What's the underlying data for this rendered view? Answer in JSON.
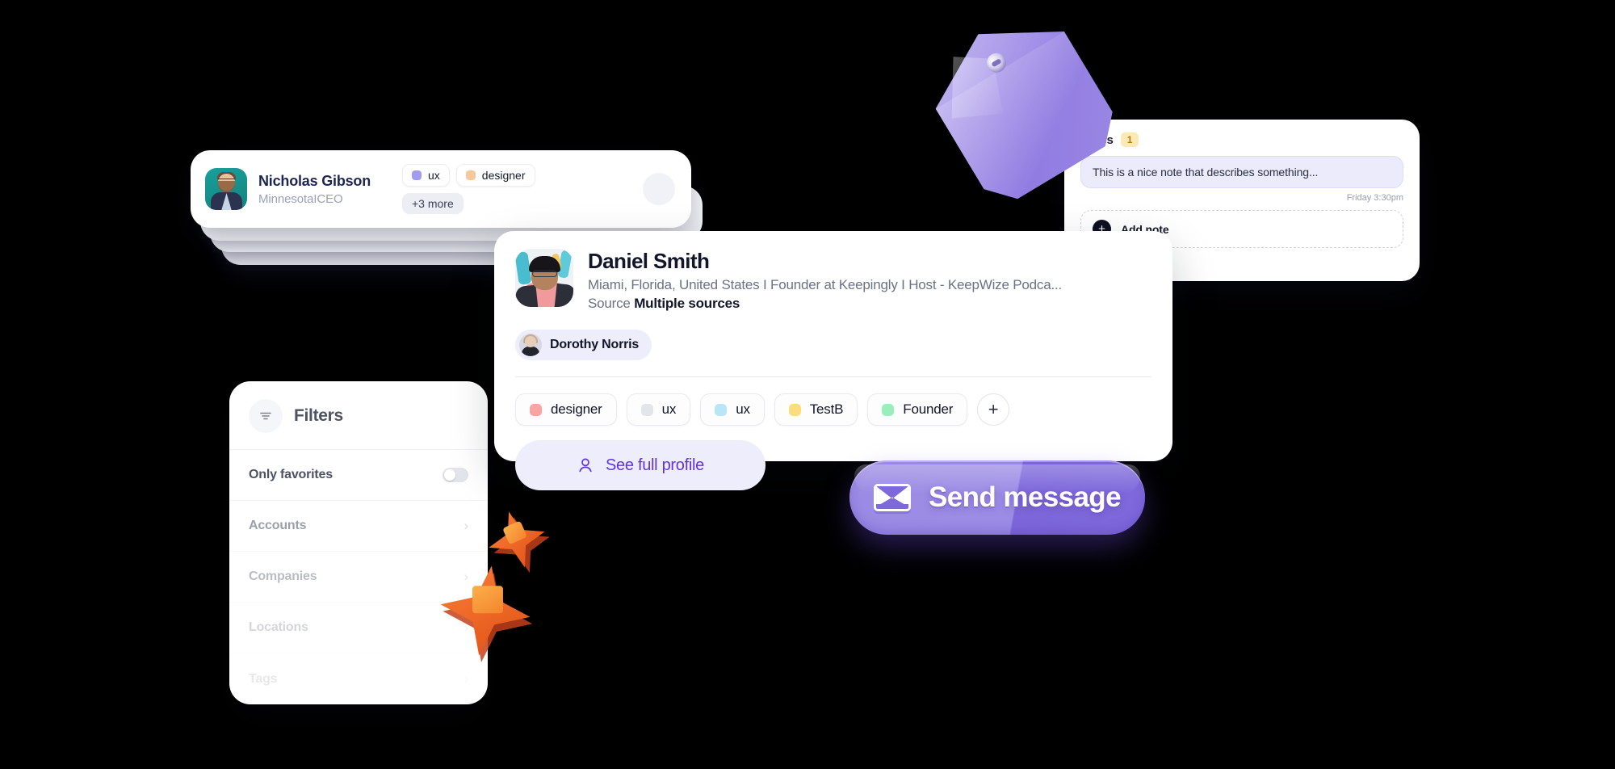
{
  "contact_stack": {
    "name": "Nicholas Gibson",
    "subtitle": "MinnesotaICEO",
    "avatar_icon": "person-avatar",
    "tags": [
      {
        "label": "ux",
        "color": "#a29cf0"
      },
      {
        "label": "designer",
        "color": "#f9c79a"
      }
    ],
    "more_label": "+3 more"
  },
  "filters": {
    "title": "Filters",
    "icon": "filter-icon",
    "only_favorites": {
      "label": "Only favorites",
      "toggle_on": false
    },
    "items": [
      {
        "label": "Accounts",
        "chevron": "chevron-right-icon"
      },
      {
        "label": "Companies",
        "chevron": "chevron-right-icon"
      },
      {
        "label": "Locations",
        "chevron": "chevron-right-icon"
      },
      {
        "label": "Tags",
        "chevron": "chevron-right-icon"
      }
    ]
  },
  "notes": {
    "title": "Notes",
    "count": "1",
    "note_text": "This is a nice note that describes something...",
    "timestamp": "Friday 3:30pm",
    "add_label": "Add note",
    "add_icon": "plus-circle-icon"
  },
  "profile": {
    "name": "Daniel Smith",
    "subtitle": "Miami, Florida, United States I Founder at Keepingly I Host - KeepWize Podca...",
    "source_label": "Source",
    "source_value": "Multiple sources",
    "avatar_icon": "person-avatar",
    "owner": {
      "name": "Dorothy Norris",
      "avatar_icon": "person-avatar"
    },
    "tags": [
      {
        "label": "designer",
        "color": "#f9a3a3"
      },
      {
        "label": "ux",
        "color": "#e4e5ea"
      },
      {
        "label": "ux",
        "color": "#b8e6f7"
      },
      {
        "label": "TestB",
        "color": "#fbdd7e"
      },
      {
        "label": "Founder",
        "color": "#9aeebb"
      }
    ],
    "add_tag_icon": "plus-icon",
    "see_profile": {
      "label": "See full profile",
      "icon": "user-icon"
    },
    "send_message": {
      "label": "Send message",
      "icon": "envelope-icon"
    }
  },
  "decorations": {
    "tag_3d": "price-tag-3d",
    "star_small": "star-3d",
    "star_large": "star-3d"
  },
  "colors": {
    "accent_purple": "#6035e0",
    "button_purple": "#8d79e0",
    "tag_orange": "#ef6a28",
    "background": "#000000"
  }
}
